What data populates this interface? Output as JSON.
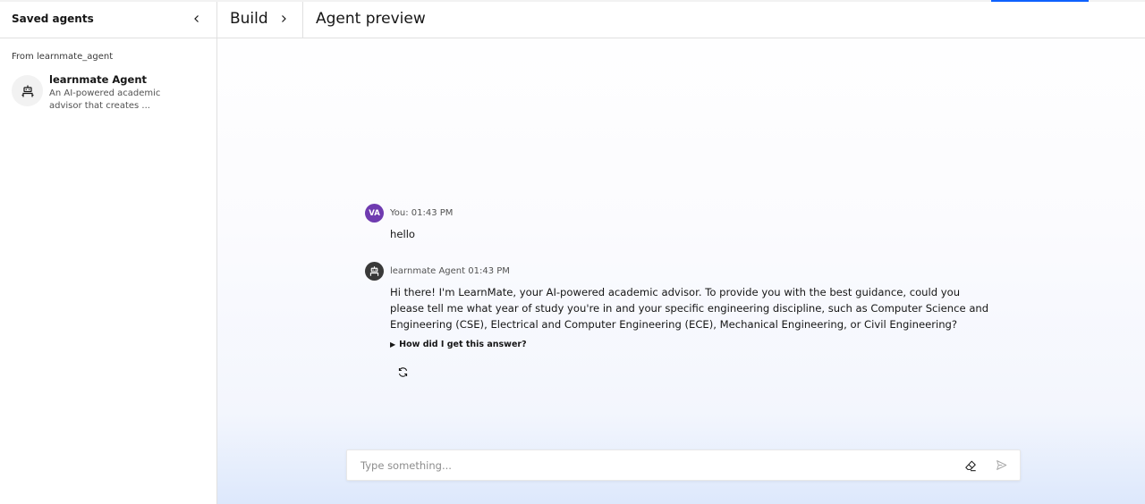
{
  "sidebar": {
    "title": "Saved agents",
    "section_label": "From learnmate_agent",
    "agents": [
      {
        "name": "learnmate Agent",
        "description_line1": "An AI-powered academic",
        "description_line2": "advisor that creates ..."
      }
    ]
  },
  "header": {
    "breadcrumb_build": "Build",
    "current_page": "Agent preview"
  },
  "chat": {
    "messages": [
      {
        "avatar_initials": "VA",
        "meta": "You: 01:43 PM",
        "text": "hello"
      },
      {
        "meta": "learnmate Agent 01:43 PM",
        "text": "Hi there! I'm LearnMate, your AI-powered academic advisor. To provide you with the best guidance, could you please tell me what year of study you're in and your specific engineering discipline, such as Computer Science and Engineering (CSE), Electrical and Computer Engineering (ECE), Mechanical Engineering, or Civil Engineering?",
        "explain_label": "How did I get this answer?"
      }
    ]
  },
  "input": {
    "placeholder": "Type something...",
    "value": ""
  },
  "icons": {
    "collapse": "chevron-left-icon",
    "breadcrumb": "chevron-right-icon",
    "agent": "robot-icon",
    "regenerate": "refresh-icon",
    "clear": "eraser-icon",
    "send": "send-icon"
  },
  "colors": {
    "accent": "#0f62fe",
    "user_avatar": "#6f3bb0",
    "agent_avatar": "#393939"
  }
}
